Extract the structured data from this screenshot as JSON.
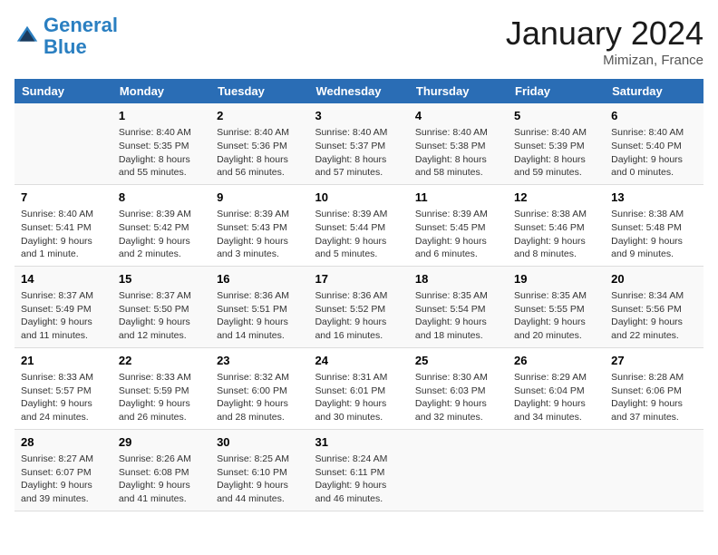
{
  "header": {
    "logo_general": "General",
    "logo_blue": "Blue",
    "month": "January 2024",
    "location": "Mimizan, France"
  },
  "days_header": [
    "Sunday",
    "Monday",
    "Tuesday",
    "Wednesday",
    "Thursday",
    "Friday",
    "Saturday"
  ],
  "weeks": [
    [
      {
        "num": "",
        "info": ""
      },
      {
        "num": "1",
        "info": "Sunrise: 8:40 AM\nSunset: 5:35 PM\nDaylight: 8 hours\nand 55 minutes."
      },
      {
        "num": "2",
        "info": "Sunrise: 8:40 AM\nSunset: 5:36 PM\nDaylight: 8 hours\nand 56 minutes."
      },
      {
        "num": "3",
        "info": "Sunrise: 8:40 AM\nSunset: 5:37 PM\nDaylight: 8 hours\nand 57 minutes."
      },
      {
        "num": "4",
        "info": "Sunrise: 8:40 AM\nSunset: 5:38 PM\nDaylight: 8 hours\nand 58 minutes."
      },
      {
        "num": "5",
        "info": "Sunrise: 8:40 AM\nSunset: 5:39 PM\nDaylight: 8 hours\nand 59 minutes."
      },
      {
        "num": "6",
        "info": "Sunrise: 8:40 AM\nSunset: 5:40 PM\nDaylight: 9 hours\nand 0 minutes."
      }
    ],
    [
      {
        "num": "7",
        "info": "Sunrise: 8:40 AM\nSunset: 5:41 PM\nDaylight: 9 hours\nand 1 minute."
      },
      {
        "num": "8",
        "info": "Sunrise: 8:39 AM\nSunset: 5:42 PM\nDaylight: 9 hours\nand 2 minutes."
      },
      {
        "num": "9",
        "info": "Sunrise: 8:39 AM\nSunset: 5:43 PM\nDaylight: 9 hours\nand 3 minutes."
      },
      {
        "num": "10",
        "info": "Sunrise: 8:39 AM\nSunset: 5:44 PM\nDaylight: 9 hours\nand 5 minutes."
      },
      {
        "num": "11",
        "info": "Sunrise: 8:39 AM\nSunset: 5:45 PM\nDaylight: 9 hours\nand 6 minutes."
      },
      {
        "num": "12",
        "info": "Sunrise: 8:38 AM\nSunset: 5:46 PM\nDaylight: 9 hours\nand 8 minutes."
      },
      {
        "num": "13",
        "info": "Sunrise: 8:38 AM\nSunset: 5:48 PM\nDaylight: 9 hours\nand 9 minutes."
      }
    ],
    [
      {
        "num": "14",
        "info": "Sunrise: 8:37 AM\nSunset: 5:49 PM\nDaylight: 9 hours\nand 11 minutes."
      },
      {
        "num": "15",
        "info": "Sunrise: 8:37 AM\nSunset: 5:50 PM\nDaylight: 9 hours\nand 12 minutes."
      },
      {
        "num": "16",
        "info": "Sunrise: 8:36 AM\nSunset: 5:51 PM\nDaylight: 9 hours\nand 14 minutes."
      },
      {
        "num": "17",
        "info": "Sunrise: 8:36 AM\nSunset: 5:52 PM\nDaylight: 9 hours\nand 16 minutes."
      },
      {
        "num": "18",
        "info": "Sunrise: 8:35 AM\nSunset: 5:54 PM\nDaylight: 9 hours\nand 18 minutes."
      },
      {
        "num": "19",
        "info": "Sunrise: 8:35 AM\nSunset: 5:55 PM\nDaylight: 9 hours\nand 20 minutes."
      },
      {
        "num": "20",
        "info": "Sunrise: 8:34 AM\nSunset: 5:56 PM\nDaylight: 9 hours\nand 22 minutes."
      }
    ],
    [
      {
        "num": "21",
        "info": "Sunrise: 8:33 AM\nSunset: 5:57 PM\nDaylight: 9 hours\nand 24 minutes."
      },
      {
        "num": "22",
        "info": "Sunrise: 8:33 AM\nSunset: 5:59 PM\nDaylight: 9 hours\nand 26 minutes."
      },
      {
        "num": "23",
        "info": "Sunrise: 8:32 AM\nSunset: 6:00 PM\nDaylight: 9 hours\nand 28 minutes."
      },
      {
        "num": "24",
        "info": "Sunrise: 8:31 AM\nSunset: 6:01 PM\nDaylight: 9 hours\nand 30 minutes."
      },
      {
        "num": "25",
        "info": "Sunrise: 8:30 AM\nSunset: 6:03 PM\nDaylight: 9 hours\nand 32 minutes."
      },
      {
        "num": "26",
        "info": "Sunrise: 8:29 AM\nSunset: 6:04 PM\nDaylight: 9 hours\nand 34 minutes."
      },
      {
        "num": "27",
        "info": "Sunrise: 8:28 AM\nSunset: 6:06 PM\nDaylight: 9 hours\nand 37 minutes."
      }
    ],
    [
      {
        "num": "28",
        "info": "Sunrise: 8:27 AM\nSunset: 6:07 PM\nDaylight: 9 hours\nand 39 minutes."
      },
      {
        "num": "29",
        "info": "Sunrise: 8:26 AM\nSunset: 6:08 PM\nDaylight: 9 hours\nand 41 minutes."
      },
      {
        "num": "30",
        "info": "Sunrise: 8:25 AM\nSunset: 6:10 PM\nDaylight: 9 hours\nand 44 minutes."
      },
      {
        "num": "31",
        "info": "Sunrise: 8:24 AM\nSunset: 6:11 PM\nDaylight: 9 hours\nand 46 minutes."
      },
      {
        "num": "",
        "info": ""
      },
      {
        "num": "",
        "info": ""
      },
      {
        "num": "",
        "info": ""
      }
    ]
  ]
}
